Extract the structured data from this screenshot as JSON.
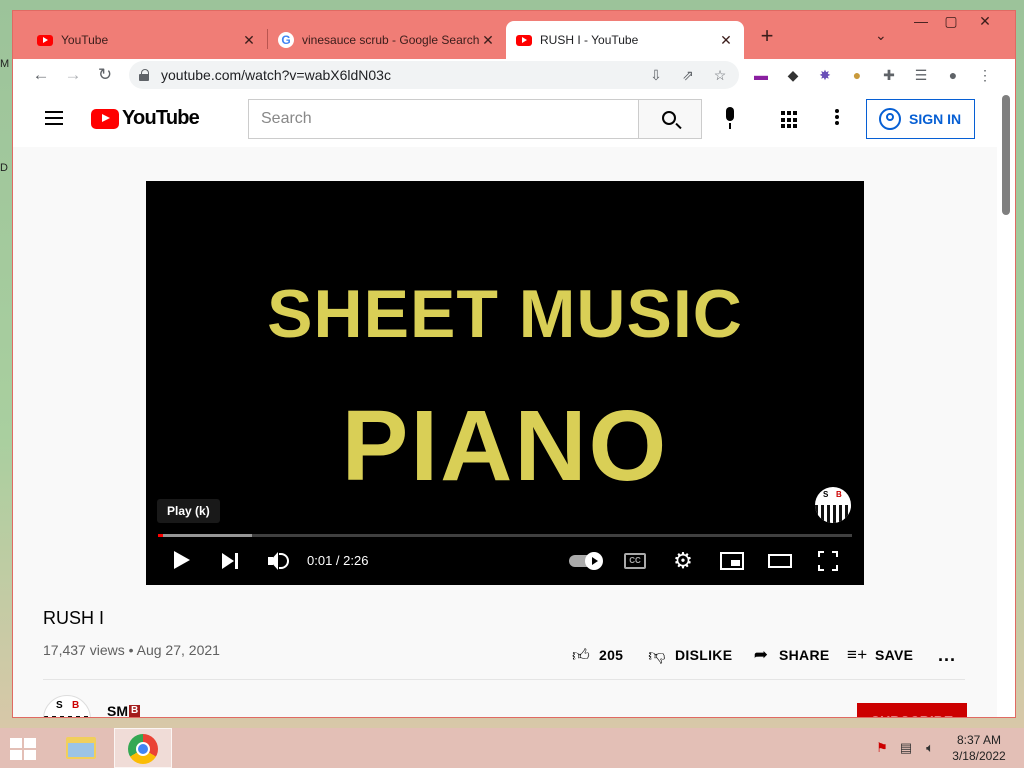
{
  "browser": {
    "tabs": [
      {
        "label": "YouTube",
        "favicon": "youtube-icon",
        "active": false
      },
      {
        "label": "vinesauce scrub - Google Search",
        "favicon": "google-icon",
        "active": false
      },
      {
        "label": "RUSH I - YouTube",
        "favicon": "youtube-icon",
        "active": true
      }
    ],
    "close_glyph": "✕",
    "new_tab_glyph": "+",
    "url": "youtube.com/watch?v=wabX6ldN03c",
    "accent_color": "#f07d76"
  },
  "youtube": {
    "logo_text": "YouTube",
    "search_placeholder": "Search",
    "sign_in_label": "SIGN IN",
    "player": {
      "thumbnail_line1": "SHEET MUSIC",
      "thumbnail_line2": "PIANO",
      "tooltip": "Play (k)",
      "watermark_s": "S",
      "watermark_b": "B",
      "time_display": "0:01 / 2:26",
      "played_fraction": 0.007,
      "buffered_fraction": 0.135
    },
    "video": {
      "title": "RUSH I",
      "meta": "17,437 views • Aug 27, 2021",
      "like_count": "205",
      "dislike_label": "DISLIKE",
      "share_label": "SHARE",
      "save_label": "SAVE",
      "more_glyph": "..."
    },
    "channel": {
      "name": "SM",
      "badge": "B",
      "avatar_s": "S",
      "avatar_b": "B",
      "subscribe_label": "SUBSCRIBE"
    }
  },
  "desktop": {
    "glyph_m": "M",
    "glyph_d": "D"
  },
  "taskbar": {
    "time": "8:37 AM",
    "date": "3/18/2022"
  }
}
